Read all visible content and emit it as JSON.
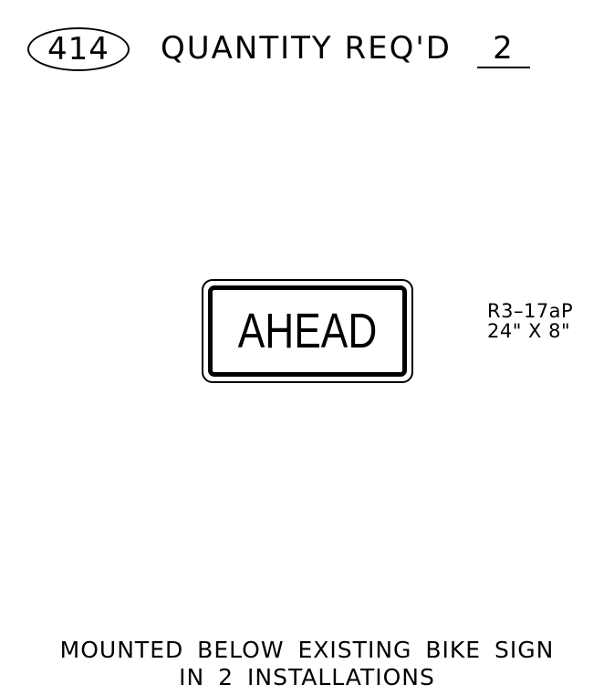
{
  "header": {
    "sheet_number": "414",
    "quantity_label": "QUANTITY REQ'D",
    "quantity_value": "2"
  },
  "sign": {
    "legend": "AHEAD",
    "code": "R3–17aP",
    "size": "24\" X 8\""
  },
  "note": {
    "line1": "MOUNTED BELOW EXISTING BIKE SIGN",
    "line2": "IN 2 INSTALLATIONS"
  }
}
